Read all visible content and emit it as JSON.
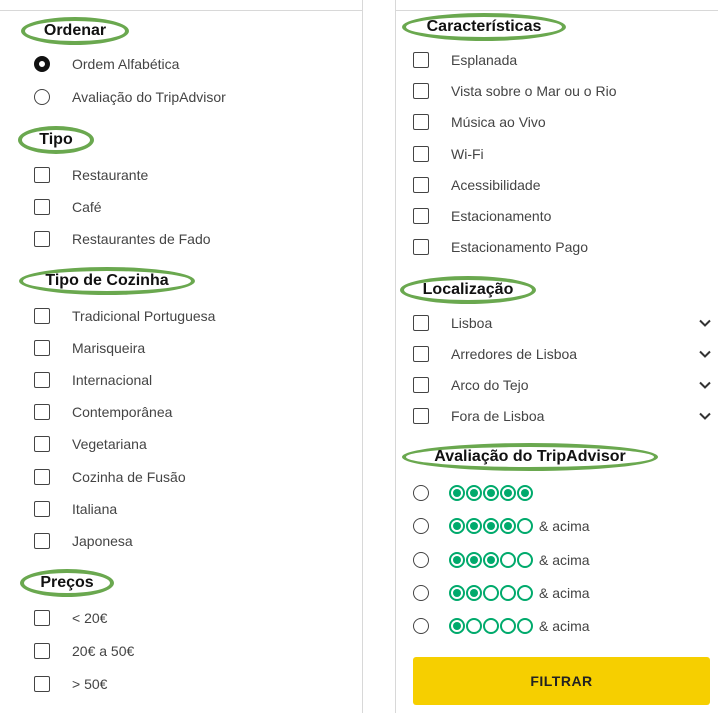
{
  "ordenar": {
    "title": "Ordenar",
    "options": [
      "Ordem Alfabética",
      "Avaliação do TripAdvisor"
    ],
    "selected_index": 0
  },
  "tipo": {
    "title": "Tipo",
    "options": [
      "Restaurante",
      "Café",
      "Restaurantes de Fado"
    ]
  },
  "cozinha": {
    "title": "Tipo de Cozinha",
    "options": [
      "Tradicional Portuguesa",
      "Marisqueira",
      "Internacional",
      "Contemporânea",
      "Vegetariana",
      "Cozinha de Fusão",
      "Italiana",
      "Japonesa"
    ]
  },
  "precos": {
    "title": "Preços",
    "options": [
      "< 20€",
      "20€ a 50€",
      "> 50€"
    ]
  },
  "caracteristicas": {
    "title": "Características",
    "options": [
      "Esplanada",
      "Vista sobre o Mar ou o Rio",
      "Música ao Vivo",
      "Wi-Fi",
      "Acessibilidade",
      "Estacionamento",
      "Estacionamento Pago"
    ]
  },
  "localizacao": {
    "title": "Localização",
    "options": [
      "Lisboa",
      "Arredores de Lisboa",
      "Arco do Tejo",
      "Fora de Lisboa"
    ]
  },
  "avaliacao": {
    "title": "Avaliação do TripAdvisor",
    "ratings": [
      {
        "filled": 5,
        "suffix": ""
      },
      {
        "filled": 4,
        "suffix": "& acima"
      },
      {
        "filled": 3,
        "suffix": "& acima"
      },
      {
        "filled": 2,
        "suffix": "& acima"
      },
      {
        "filled": 1,
        "suffix": "& acima"
      }
    ]
  },
  "button": {
    "label": "FILTRAR",
    "color": "#f6cf00"
  },
  "colors": {
    "accent_green": "#00aa6c",
    "highlight_green": "#6aa84f"
  }
}
